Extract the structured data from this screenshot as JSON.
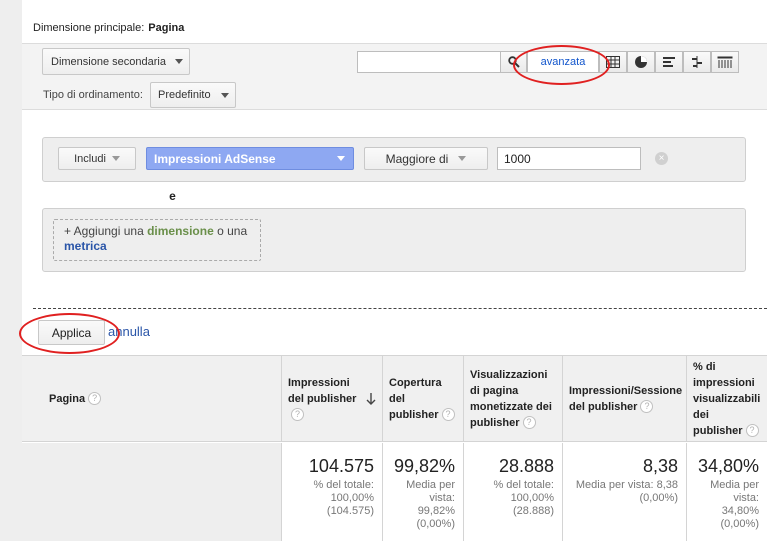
{
  "header": {
    "dim_label": "Dimensione principale:",
    "dim_value": "Pagina"
  },
  "toolbar": {
    "secondary_dim": "Dimensione secondaria",
    "sort_label": "Tipo di ordinamento:",
    "sort_value": "Predefinito",
    "search_value": "",
    "advanced_label": "avanzata",
    "view_icons": [
      "table-view-icon",
      "pie-view-icon",
      "performance-view-icon",
      "comparison-view-icon",
      "pivot-view-icon"
    ]
  },
  "filter": {
    "include_label": "Includi",
    "metric_label": "Impressioni AdSense",
    "operator_label": "Maggiore di",
    "value": "1000",
    "and_label": "e",
    "add_prefix": "+ Aggiungi una ",
    "add_dimension": "dimensione",
    "add_or": " o una",
    "add_metric": "metrica"
  },
  "actions": {
    "apply_label": "Applica",
    "cancel_label": "annulla"
  },
  "table": {
    "headers": [
      "Pagina",
      "Impressioni del publisher",
      "Copertura del publisher",
      "Visualizzazioni di pagina monetizzate dei publisher",
      "Impressioni/Sessione del publisher",
      "% di impressioni visualizzabili dei publisher"
    ],
    "totals": [
      {
        "value": "104.575",
        "sub": "% del totale: 100,00% (104.575)"
      },
      {
        "value": "99,82%",
        "sub": "Media per vista: 99,82% (0,00%)"
      },
      {
        "value": "28.888",
        "sub": "% del totale: 100,00% (28.888)"
      },
      {
        "value": "8,38",
        "sub": "Media per vista: 8,38 (0,00%)"
      },
      {
        "value": "34,80%",
        "sub": "Media per vista: 34,80% (0,00%)"
      }
    ]
  },
  "colors": {
    "accent": "#1155cc",
    "metric_chip": "#8ea8f2",
    "highlight_oval": "#e02020"
  }
}
